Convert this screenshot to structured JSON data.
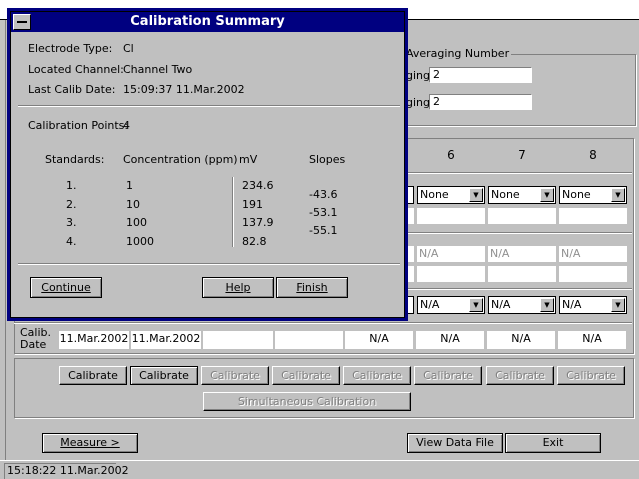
{
  "background": {
    "averaging_group": "Averaging Number",
    "averaging_fields": [
      {
        "label_fragment": "ging:",
        "value": "2"
      },
      {
        "label_fragment": "ging:",
        "value": "2"
      }
    ],
    "column_headers": [
      "6",
      "7",
      "8"
    ],
    "selects": [
      "None",
      "None",
      "None"
    ],
    "na_row_1": [
      "N/A",
      "N/A",
      "N/A"
    ],
    "calib_date_label": "Calib.\nDate",
    "calib_dates": [
      "11.Mar.2002",
      "11.Mar.2002",
      "",
      "",
      "N/A",
      "N/A",
      "N/A",
      "N/A"
    ],
    "calibrate_buttons": [
      "Calibrate",
      "Calibrate",
      "Calibrate",
      "Calibrate",
      "Calibrate",
      "Calibrate",
      "Calibrate",
      "Calibrate"
    ],
    "simultaneous_button": "Simultaneous Calibration",
    "measure_button": "Measure >",
    "view_data_button": "View Data File",
    "exit_button": "Exit",
    "status_time": "15:18:22 11.Mar.2002"
  },
  "dialog": {
    "title": "Calibration Summary",
    "electrode_type_label": "Electrode Type:",
    "electrode_type": "Cl",
    "located_channel_label": "Located Channel:",
    "located_channel": "Channel Two",
    "last_calib_label": "Last Calib Date:",
    "last_calib": "15:09:37 11.Mar.2002",
    "calib_points_label": "Calibration Points:",
    "calib_points": "4",
    "headers": {
      "standards": "Standards:",
      "concentration": "Concentration (ppm)",
      "mv": "mV",
      "slopes": "Slopes"
    },
    "rows": [
      {
        "index": "1.",
        "conc": "1",
        "mv": "234.6"
      },
      {
        "index": "2.",
        "conc": "10",
        "mv": "191"
      },
      {
        "index": "3.",
        "conc": "100",
        "mv": "137.9"
      },
      {
        "index": "4.",
        "conc": "1000",
        "mv": "82.8"
      }
    ],
    "slopes": [
      "-43.6",
      "-53.1",
      "-55.1"
    ],
    "continue_button": "Continue",
    "help_button": "Help",
    "finish_button": "Finish"
  }
}
